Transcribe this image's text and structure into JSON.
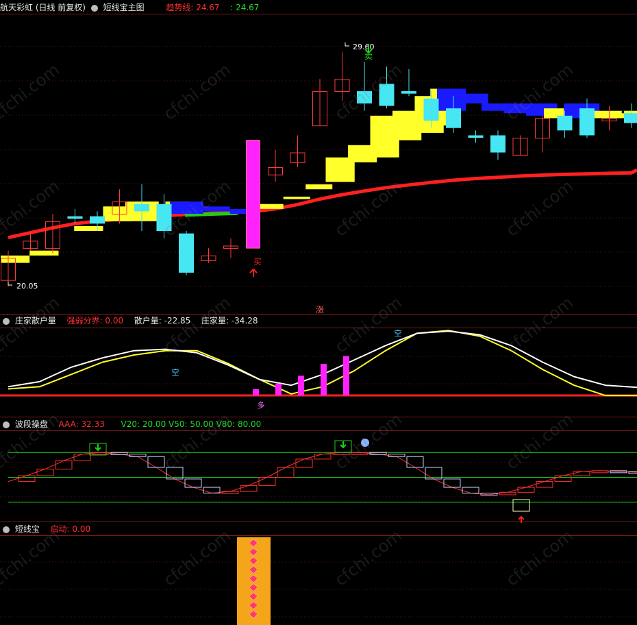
{
  "colors": {
    "red": "#ff2020",
    "green": "#1bd11b",
    "yellow": "#ffff2a",
    "cyan": "#46e6f2",
    "blue": "#1a1aff",
    "magenta": "#ff22ff",
    "white": "#ffffff",
    "grid": "#5a1414",
    "gold": "#f5a51a"
  },
  "panel1": {
    "title": "航天彩虹 (日线 前复权)",
    "indicator": "短线宝主图",
    "trend_label": "趋势线:",
    "trend_value": "24.67",
    "value2": ": 24.67"
  },
  "panel2": {
    "title": "庄家散户量",
    "l1": "强弱分界:",
    "v1": "0.00",
    "l2": "散户量:",
    "v2": "-22.85",
    "l3": "庄家量:",
    "v3": "-34.28"
  },
  "panel3": {
    "title": "波段操盘",
    "l1": "AAA:",
    "v1": "32.33",
    "l2": "V20:",
    "v2": "20.00",
    "l3": "V50:",
    "v3": "50.00",
    "l4": "V80:",
    "v4": "80.00"
  },
  "panel4": {
    "title": "短线宝",
    "l1": "启动:",
    "v1": "0.00"
  },
  "watermark": "cfchi.com",
  "chart_data": [
    {
      "type": "candlestick",
      "panel": "短线宝主图",
      "ylim": [
        19.2,
        30.6
      ],
      "annotations": {
        "high_label": "29.60",
        "low_label": "20.05",
        "buy": "买",
        "sell": "卖",
        "rise": "涨"
      },
      "candles": [
        {
          "o": 21.2,
          "h": 21.5,
          "c": 20.3,
          "l": 20.05
        },
        {
          "o": 21.6,
          "h": 22.3,
          "c": 21.9,
          "l": 21.5
        },
        {
          "o": 21.6,
          "h": 23.0,
          "c": 22.7,
          "l": 21.4
        },
        {
          "o": 22.9,
          "h": 23.2,
          "c": 22.8,
          "l": 22.6
        },
        {
          "o": 22.9,
          "h": 23.1,
          "c": 22.6,
          "l": 22.3
        },
        {
          "o": 23.0,
          "h": 24.0,
          "c": 23.5,
          "l": 22.6
        },
        {
          "o": 23.4,
          "h": 24.2,
          "c": 23.1,
          "l": 22.3
        },
        {
          "o": 23.4,
          "h": 23.8,
          "c": 22.3,
          "l": 22.0
        },
        {
          "o": 22.2,
          "h": 22.3,
          "c": 20.6,
          "l": 20.5
        },
        {
          "o": 21.1,
          "h": 21.6,
          "c": 21.3,
          "l": 21.0
        },
        {
          "o": 21.7,
          "h": 22.0,
          "c": 21.6,
          "l": 21.2
        },
        {
          "o": 21.6,
          "h": 23.2,
          "c": 23.2,
          "l": 21.6
        },
        {
          "o": 24.6,
          "h": 25.6,
          "c": 24.9,
          "l": 24.3
        },
        {
          "o": 25.1,
          "h": 26.2,
          "c": 25.5,
          "l": 24.9
        },
        {
          "o": 26.6,
          "h": 28.5,
          "c": 28.0,
          "l": 26.6
        },
        {
          "o": 28.0,
          "h": 29.6,
          "c": 28.5,
          "l": 27.6
        },
        {
          "o": 28.0,
          "h": 29.2,
          "c": 27.5,
          "l": 27.2
        },
        {
          "o": 27.4,
          "h": 29.0,
          "c": 28.3,
          "l": 27.3
        },
        {
          "o": 28.0,
          "h": 28.9,
          "c": 27.9,
          "l": 27.8
        },
        {
          "o": 27.7,
          "h": 28.0,
          "c": 26.8,
          "l": 26.5
        },
        {
          "o": 27.3,
          "h": 27.8,
          "c": 26.5,
          "l": 26.3
        },
        {
          "o": 26.2,
          "h": 26.4,
          "c": 26.1,
          "l": 25.9
        },
        {
          "o": 26.2,
          "h": 26.4,
          "c": 25.5,
          "l": 25.2
        },
        {
          "o": 25.4,
          "h": 26.2,
          "c": 26.1,
          "l": 25.4
        },
        {
          "o": 26.1,
          "h": 27.0,
          "c": 26.9,
          "l": 25.5
        },
        {
          "o": 27.0,
          "h": 27.2,
          "c": 26.4,
          "l": 26.1
        },
        {
          "o": 26.2,
          "h": 27.7,
          "c": 27.3,
          "l": 26.1
        },
        {
          "o": 26.8,
          "h": 27.4,
          "c": 26.9,
          "l": 26.4
        },
        {
          "o": 27.1,
          "h": 27.5,
          "c": 26.7,
          "l": 26.5
        }
      ],
      "trend_line": [
        22.03,
        22.23,
        22.43,
        22.6,
        22.7,
        22.78,
        22.85,
        22.92,
        22.98,
        23.02,
        23.05,
        23.09,
        23.2,
        23.38,
        23.6,
        23.78,
        23.93,
        24.07,
        24.18,
        24.28,
        24.37,
        24.44,
        24.49,
        24.54,
        24.58,
        24.61,
        24.63,
        24.65,
        24.67
      ]
    },
    {
      "type": "line",
      "panel": "庄家散户量",
      "ylim": [
        -35,
        60
      ],
      "series": [
        {
          "name": "散户量",
          "values": [
            -22.0,
            -15.0,
            5.0,
            18.0,
            28.0,
            30.0,
            25.0,
            8.0,
            -12.0,
            -20.0,
            -5.0,
            15.0,
            35.0,
            52.0,
            55.0,
            50.0,
            35.0,
            12.0,
            -8.0,
            -20.0,
            -22.85
          ]
        },
        {
          "name": "庄家量",
          "values": [
            -25.0,
            -22.0,
            -5.0,
            12.0,
            22.0,
            28.0,
            28.0,
            10.0,
            -12.0,
            -32.0,
            -22.0,
            0.0,
            28.0,
            52.0,
            56.0,
            48.0,
            28.0,
            2.0,
            -20.0,
            -34.28,
            -34.28
          ]
        }
      ],
      "bars": [
        8,
        15,
        25,
        40,
        50
      ],
      "baseline": 0,
      "labels": [
        "多",
        "空"
      ]
    },
    {
      "type": "step",
      "panel": "波段操盘",
      "ylim": [
        5,
        100
      ],
      "values": [
        45,
        52,
        60,
        70,
        78,
        80,
        78,
        75,
        62,
        48,
        38,
        31,
        33,
        40,
        50,
        62,
        72,
        78,
        80,
        80,
        78,
        75,
        62,
        48,
        38,
        31,
        29,
        32,
        38,
        45,
        52,
        57,
        58,
        57,
        56
      ],
      "levels": [
        20,
        50,
        80
      ]
    },
    {
      "type": "bar",
      "panel": "短线宝",
      "values": [
        1
      ],
      "label": "启动"
    }
  ]
}
